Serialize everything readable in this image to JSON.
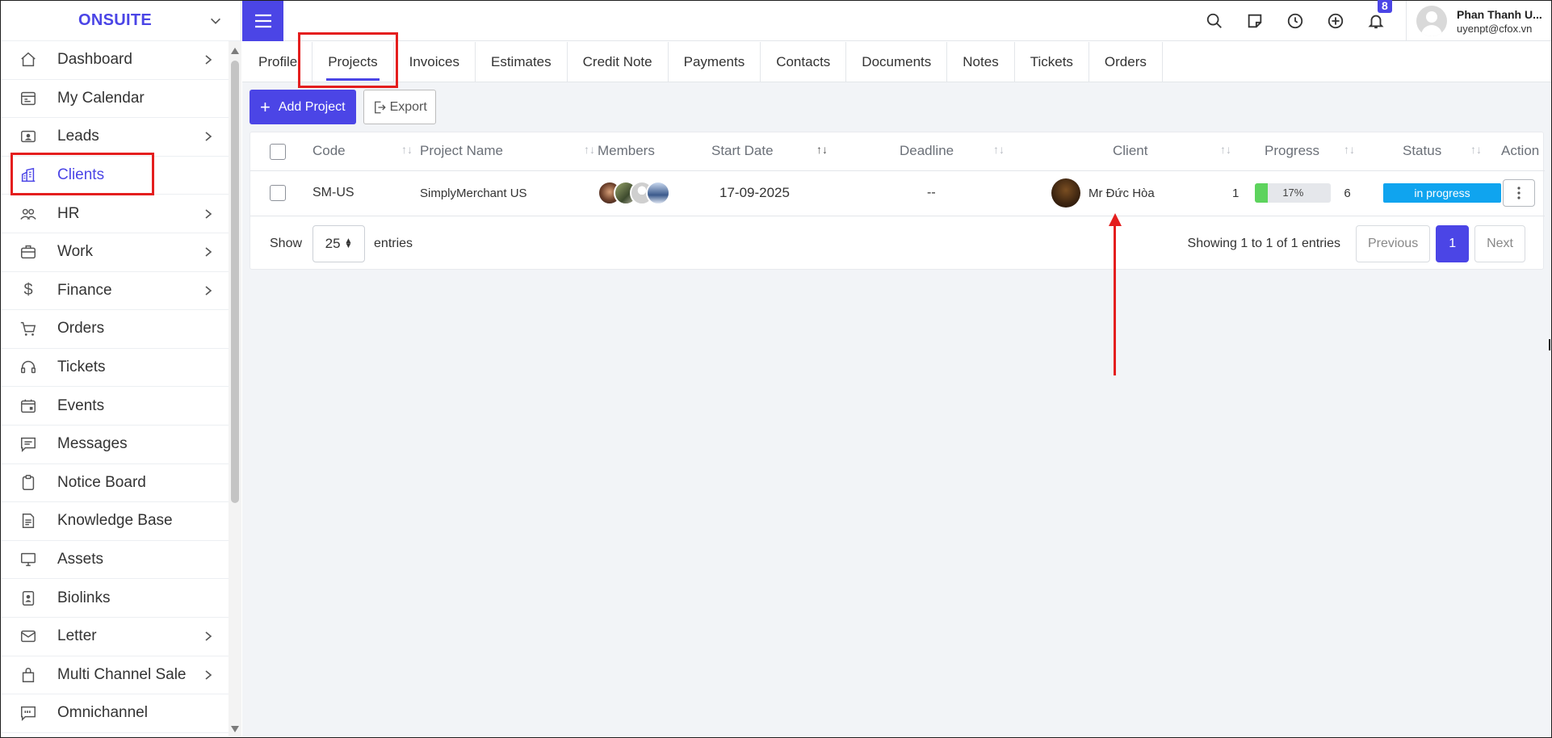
{
  "brand": {
    "name": "ONSUITE"
  },
  "sidebar": {
    "items": [
      {
        "label": "Dashboard",
        "icon": "home-icon",
        "has_arrow": true
      },
      {
        "label": "My Calendar",
        "icon": "calendar-icon",
        "has_arrow": false
      },
      {
        "label": "Leads",
        "icon": "id-card-icon",
        "has_arrow": true
      },
      {
        "label": "Clients",
        "icon": "building-icon",
        "has_arrow": false,
        "active": true
      },
      {
        "label": "HR",
        "icon": "users-icon",
        "has_arrow": true
      },
      {
        "label": "Work",
        "icon": "briefcase-icon",
        "has_arrow": true
      },
      {
        "label": "Finance",
        "icon": "dollar-icon",
        "has_arrow": true
      },
      {
        "label": "Orders",
        "icon": "cart-icon",
        "has_arrow": false
      },
      {
        "label": "Tickets",
        "icon": "headset-icon",
        "has_arrow": false
      },
      {
        "label": "Events",
        "icon": "calendar-event-icon",
        "has_arrow": false
      },
      {
        "label": "Messages",
        "icon": "message-icon",
        "has_arrow": false
      },
      {
        "label": "Notice Board",
        "icon": "clipboard-icon",
        "has_arrow": false
      },
      {
        "label": "Knowledge Base",
        "icon": "document-icon",
        "has_arrow": false
      },
      {
        "label": "Assets",
        "icon": "monitor-icon",
        "has_arrow": false
      },
      {
        "label": "Biolinks",
        "icon": "person-badge-icon",
        "has_arrow": false
      },
      {
        "label": "Letter",
        "icon": "envelope-icon",
        "has_arrow": true
      },
      {
        "label": "Multi Channel Sale",
        "icon": "bag-icon",
        "has_arrow": true
      },
      {
        "label": "Omnichannel",
        "icon": "chat-quote-icon",
        "has_arrow": false
      }
    ]
  },
  "header": {
    "notification_count": "8",
    "user_name": "Phan Thanh U...",
    "user_email": "uyenpt@cfox.vn"
  },
  "tabs": [
    {
      "label": "Profile"
    },
    {
      "label": "Projects",
      "active": true
    },
    {
      "label": "Invoices"
    },
    {
      "label": "Estimates"
    },
    {
      "label": "Credit Note"
    },
    {
      "label": "Payments"
    },
    {
      "label": "Contacts"
    },
    {
      "label": "Documents"
    },
    {
      "label": "Notes"
    },
    {
      "label": "Tickets"
    },
    {
      "label": "Orders"
    }
  ],
  "toolbar": {
    "add_label": "Add Project",
    "export_label": "Export"
  },
  "table": {
    "columns": [
      "Code",
      "Project Name",
      "Members",
      "Start Date",
      "Deadline",
      "Client",
      "Progress",
      "Status",
      "Action"
    ],
    "rows": [
      {
        "code": "SM-US",
        "name": "SimplyMerchant US",
        "start_date": "17-09-2025",
        "deadline": "--",
        "client": "Mr Đức Hòa",
        "progress_left": "1",
        "progress_pct": 17,
        "progress_label": "17%",
        "progress_right": "6",
        "status": "in progress"
      }
    ]
  },
  "footer": {
    "show_label": "Show",
    "entries_value": "25",
    "entries_label": "entries",
    "info": "Showing 1 to 1 of 1 entries",
    "prev": "Previous",
    "page": "1",
    "next": "Next"
  },
  "colors": {
    "accent": "#4b45e6",
    "status": "#0fa4ef",
    "progress": "#5dd35d",
    "annotation": "#e41e1e"
  }
}
